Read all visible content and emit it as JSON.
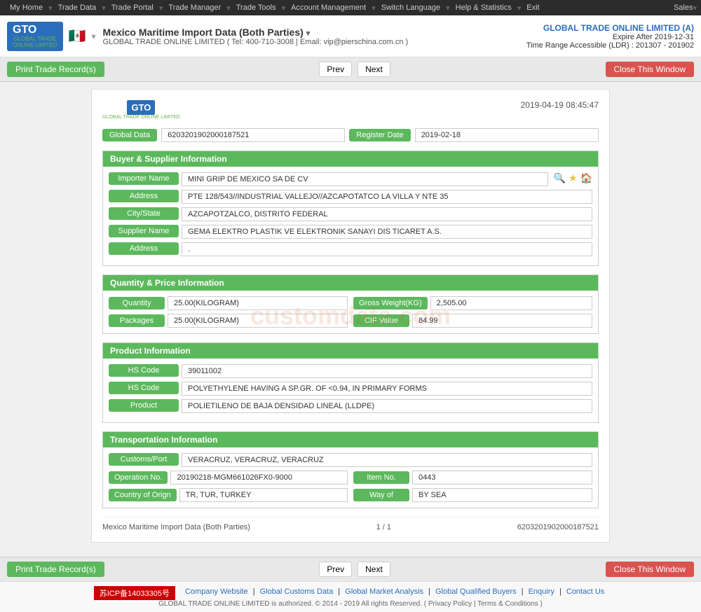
{
  "topnav": {
    "items": [
      "My Home",
      "Trade Data",
      "Trade Portal",
      "Trade Manager",
      "Trade Tools",
      "Account Management",
      "Switch Language",
      "Help & Statistics",
      "Exit"
    ],
    "sales": "Sales"
  },
  "header": {
    "logo_text": "GTO",
    "logo_sub": "GLOBAL TRADE ONLINE LIMITED",
    "flag_emoji": "🇲🇽",
    "title": "Mexico Maritime Import Data (Both Parties)",
    "company_line": "GLOBAL TRADE ONLINE LIMITED ( Tel: 400-710-3008 | Email: vip@pierschina.com.cn )",
    "right_company": "GLOBAL TRADE ONLINE LIMITED (A)",
    "right_expire": "Expire After 2019-12-31",
    "right_ldr": "Time Range Accessible (LDR) : 201307 - 201902"
  },
  "toolbar": {
    "print_label": "Print Trade Record(s)",
    "prev_label": "Prev",
    "next_label": "Next",
    "close_label": "Close This Window"
  },
  "card": {
    "timestamp": "2019-04-19 08:45:47",
    "global_data_label": "Global Data",
    "global_data_value": "6203201902000187521",
    "register_date_label": "Register Date",
    "register_date_value": "2019-02-18",
    "buyer_supplier_section": "Buyer & Supplier Information",
    "importer_name_label": "Importer Name",
    "importer_name_value": "MINI GRIP DE MEXICO SA DE CV",
    "address_label": "Address",
    "address_value": "PTE 128/543//INDUSTRIAL VALLEJO//AZCAPOTATCO LA VILLA Y NTE 35",
    "city_state_label": "City/State",
    "city_state_value": "AZCAPOTZALCO, DISTRITO FEDERAL",
    "supplier_name_label": "Supplier Name",
    "supplier_name_value": "GEMA ELEKTRO PLASTIK VE ELEKTRONIK SANAYI DIS TICARET A.S.",
    "supplier_address_label": "Address",
    "supplier_address_value": ".",
    "quantity_section": "Quantity & Price Information",
    "quantity_label": "Quantity",
    "quantity_value": "25.00(KILOGRAM)",
    "gross_weight_label": "Gross Weight(KG)",
    "gross_weight_value": "2,505.00",
    "packages_label": "Packages",
    "packages_value": "25.00(KILOGRAM)",
    "cif_value_label": "CIF Value",
    "cif_value_value": "84.99",
    "product_section": "Product Information",
    "hs_code_label": "HS Code",
    "hs_code_value": "39011002",
    "hs_code_desc_label": "HS Code",
    "hs_code_desc_value": "POLYETHYLENE HAVING A SP.GR. OF <0.94, IN PRIMARY FORMS",
    "product_label": "Product",
    "product_value": "POLIETILENO DE BAJA DENSIDAD LINEAL (LLDPE)",
    "transportation_section": "Transportation Information",
    "customs_port_label": "Customs/Port",
    "customs_port_value": "VERACRUZ, VERACRUZ, VERACRUZ",
    "operation_no_label": "Operation No.",
    "operation_no_value": "20190218-MGM661026FX0-9000",
    "item_no_label": "Item No.",
    "item_no_value": "0443",
    "country_origin_label": "Country of Orign",
    "country_origin_value": "TR, TUR, TURKEY",
    "way_of_label": "Way of",
    "way_of_value": "BY SEA",
    "footer_title": "Mexico Maritime Import Data (Both Parties)",
    "footer_page": "1 / 1",
    "footer_record": "6203201902000187521"
  },
  "watermark": "customdata.com",
  "footer": {
    "beian": "苏ICP备14033305号",
    "links": [
      "Company Website",
      "Global Customs Data",
      "Global Market Analysis",
      "Global Qualified Buyers",
      "Enquiry",
      "Contact Us"
    ],
    "copyright": "GLOBAL TRADE ONLINE LIMITED is authorized. © 2014 - 2019 All rights Reserved.  (  Privacy Policy  |  Terms & Conditions  )"
  }
}
